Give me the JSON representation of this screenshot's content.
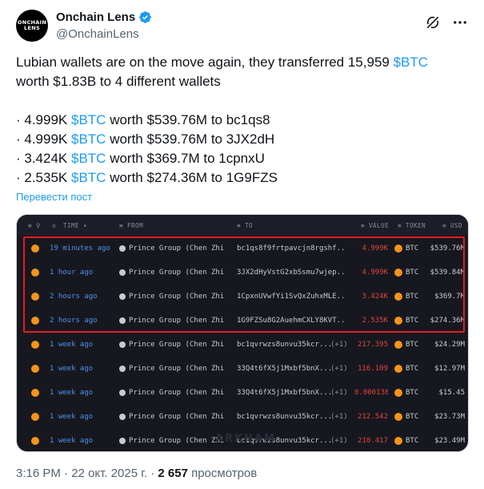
{
  "author": {
    "avatar_text": "ONCHAIN LENS",
    "display_name": "Onchain Lens",
    "handle": "@OnchainLens",
    "verified_color": "#1d9bf0"
  },
  "icons": [
    "grok-icon",
    "more-icon",
    "verified-badge-icon",
    "btc-coin-icon"
  ],
  "tweet": {
    "line1_prefix": "Lubian wallets are on the move again, they transferred 15,959 ",
    "line1_cashtag": "$BTC",
    "line2": "worth $1.83B to 4 different wallets",
    "bullets": [
      {
        "prefix": "· 4.999K ",
        "cashtag": "$BTC",
        "suffix": " worth $539.76M to bc1qs8"
      },
      {
        "prefix": "· 4.999K ",
        "cashtag": "$BTC",
        "suffix": " worth $539.76M to 3JX2dH"
      },
      {
        "prefix": "· 3.424K ",
        "cashtag": "$BTC",
        "suffix": " worth $369.7M to 1cpnxU"
      },
      {
        "prefix": "· 2.535K ",
        "cashtag": "$BTC",
        "suffix": " worth $274.36M to 1G9FZS"
      }
    ],
    "translate_label": "Перевести пост"
  },
  "table": {
    "headers": {
      "time": "TIME",
      "from": "FROM",
      "to": "TO",
      "value": "VALUE",
      "token": "TOKEN",
      "usd": "USD"
    },
    "rows": [
      {
        "time": "19 minutes ago",
        "from": "Prince Group (Chen Zhi",
        "to": "bc1qs8f9frtpavcjn8rgshf...",
        "to_extra": "",
        "value": "4.999K",
        "token": "BTC",
        "usd": "$539.76M"
      },
      {
        "time": "1 hour ago",
        "from": "Prince Group (Chen Zhi",
        "to": "3JX2dHyVstG2xbSsmu7wjep...",
        "to_extra": "",
        "value": "4.999K",
        "token": "BTC",
        "usd": "$539.84M"
      },
      {
        "time": "2 hours ago",
        "from": "Prince Group (Chen Zhi",
        "to": "1CpxnUVwfYi1SvQxZuhxMLE...",
        "to_extra": "",
        "value": "3.424K",
        "token": "BTC",
        "usd": "$369.7M"
      },
      {
        "time": "2 hours ago",
        "from": "Prince Group (Chen Zhi",
        "to": "1G9FZSu8G2AuehmCXLY8KVT...",
        "to_extra": "",
        "value": "2.535K",
        "token": "BTC",
        "usd": "$274.36M"
      },
      {
        "time": "1 week ago",
        "from": "Prince Group (Chen Zhi",
        "to": "bc1qvrwzs8unvu35kcr...",
        "to_extra": "(+1)",
        "value": "217.395",
        "token": "BTC",
        "usd": "$24.29M"
      },
      {
        "time": "1 week ago",
        "from": "Prince Group (Chen Zhi",
        "to": "33Q4t6fX5j1Mxbf5bnX...",
        "to_extra": "(+1)",
        "value": "116.109",
        "token": "BTC",
        "usd": "$12.97M"
      },
      {
        "time": "1 week ago",
        "from": "Prince Group (Chen Zhi",
        "to": "33Q4t6fX5j1Mxbf5bnX...",
        "to_extra": "(+1)",
        "value": "0.000138",
        "token": "BTC",
        "usd": "$15.45"
      },
      {
        "time": "1 week ago",
        "from": "Prince Group (Chen Zhi",
        "to": "bc1qvrwzs8unvu35kcr...",
        "to_extra": "(+1)",
        "value": "212.542",
        "token": "BTC",
        "usd": "$23.73M"
      },
      {
        "time": "1 week ago",
        "from": "Prince Group (Chen Zhi",
        "to": "bc1qvrwzs8unvu35kcr...",
        "to_extra": "(+1)",
        "value": "210.417",
        "token": "BTC",
        "usd": "$23.49M"
      }
    ],
    "watermark": "ARKHAM",
    "highlight_color": "#e11d24"
  },
  "footer": {
    "time": "3:16 PM",
    "separator": " · ",
    "date": "22 окт. 2025 г.",
    "views_count": "2 657",
    "views_label": " просмотров"
  }
}
